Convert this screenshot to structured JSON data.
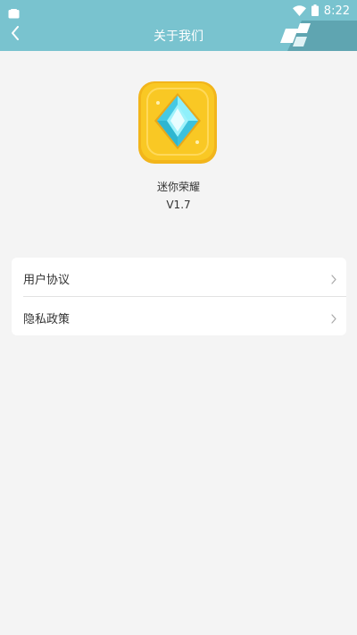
{
  "status_bar": {
    "time": "8:22",
    "icons": [
      "app-notification-icon",
      "wifi-icon",
      "battery-icon"
    ]
  },
  "nav": {
    "title": "关于我们",
    "back_icon": "chevron-left-icon"
  },
  "app": {
    "name": "迷你荣耀",
    "version": "V1.7",
    "logo_icon": "diamond-gem-icon"
  },
  "menu": {
    "items": [
      {
        "label": "用户协议",
        "icon": "chevron-right-icon"
      },
      {
        "label": "隐私政策",
        "icon": "chevron-right-icon"
      }
    ]
  },
  "colors": {
    "header": "#79c3cf",
    "page_background": "#f4f4f4",
    "card_background": "#ffffff",
    "logo_gold": "#f9c824",
    "gem_cyan": "#56d8ec"
  }
}
